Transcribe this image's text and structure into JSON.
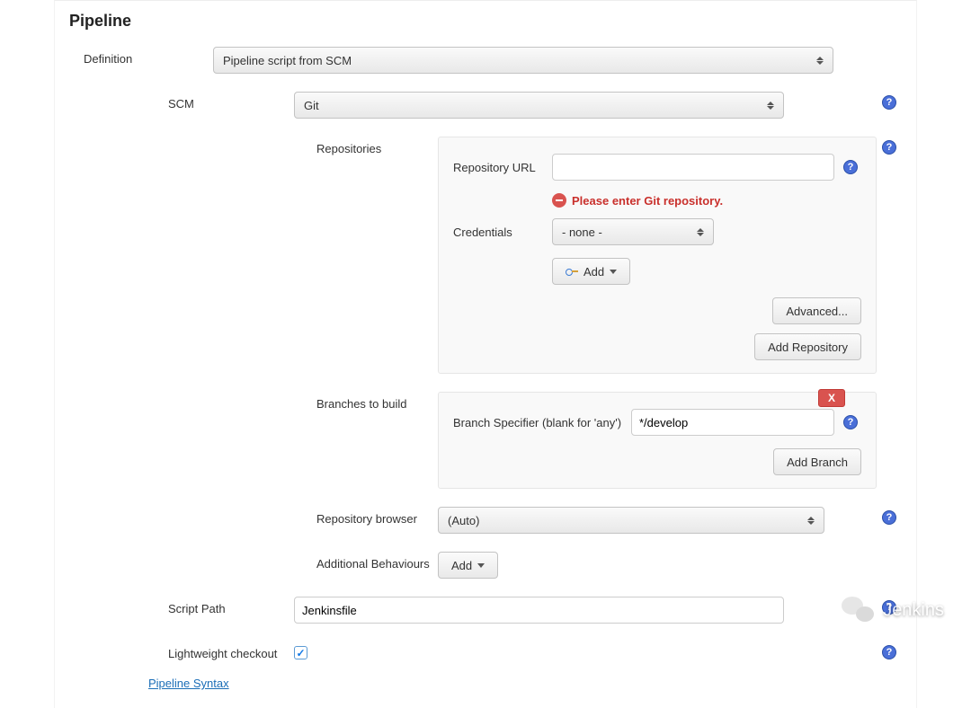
{
  "section": {
    "title": "Pipeline"
  },
  "definition": {
    "label": "Definition",
    "selected": "Pipeline script from SCM"
  },
  "scm": {
    "label": "SCM",
    "selected": "Git"
  },
  "repositories": {
    "label": "Repositories",
    "url_label": "Repository URL",
    "url_value": "",
    "error_text": "Please enter Git repository.",
    "credentials_label": "Credentials",
    "credentials_selected": "- none -",
    "add_button": "Add",
    "advanced_button": "Advanced...",
    "add_repository_button": "Add Repository"
  },
  "branches": {
    "label": "Branches to build",
    "delete_label": "X",
    "specifier_label": "Branch Specifier (blank for 'any')",
    "specifier_value": "*/develop",
    "add_branch_button": "Add Branch"
  },
  "repo_browser": {
    "label": "Repository browser",
    "selected": "(Auto)"
  },
  "additional_behaviours": {
    "label": "Additional Behaviours",
    "add_button": "Add"
  },
  "script_path": {
    "label": "Script Path",
    "value": "Jenkinsfile"
  },
  "lightweight": {
    "label": "Lightweight checkout",
    "checked": true
  },
  "pipeline_syntax_link": "Pipeline Syntax",
  "watermark": {
    "text": "Jenkins"
  }
}
